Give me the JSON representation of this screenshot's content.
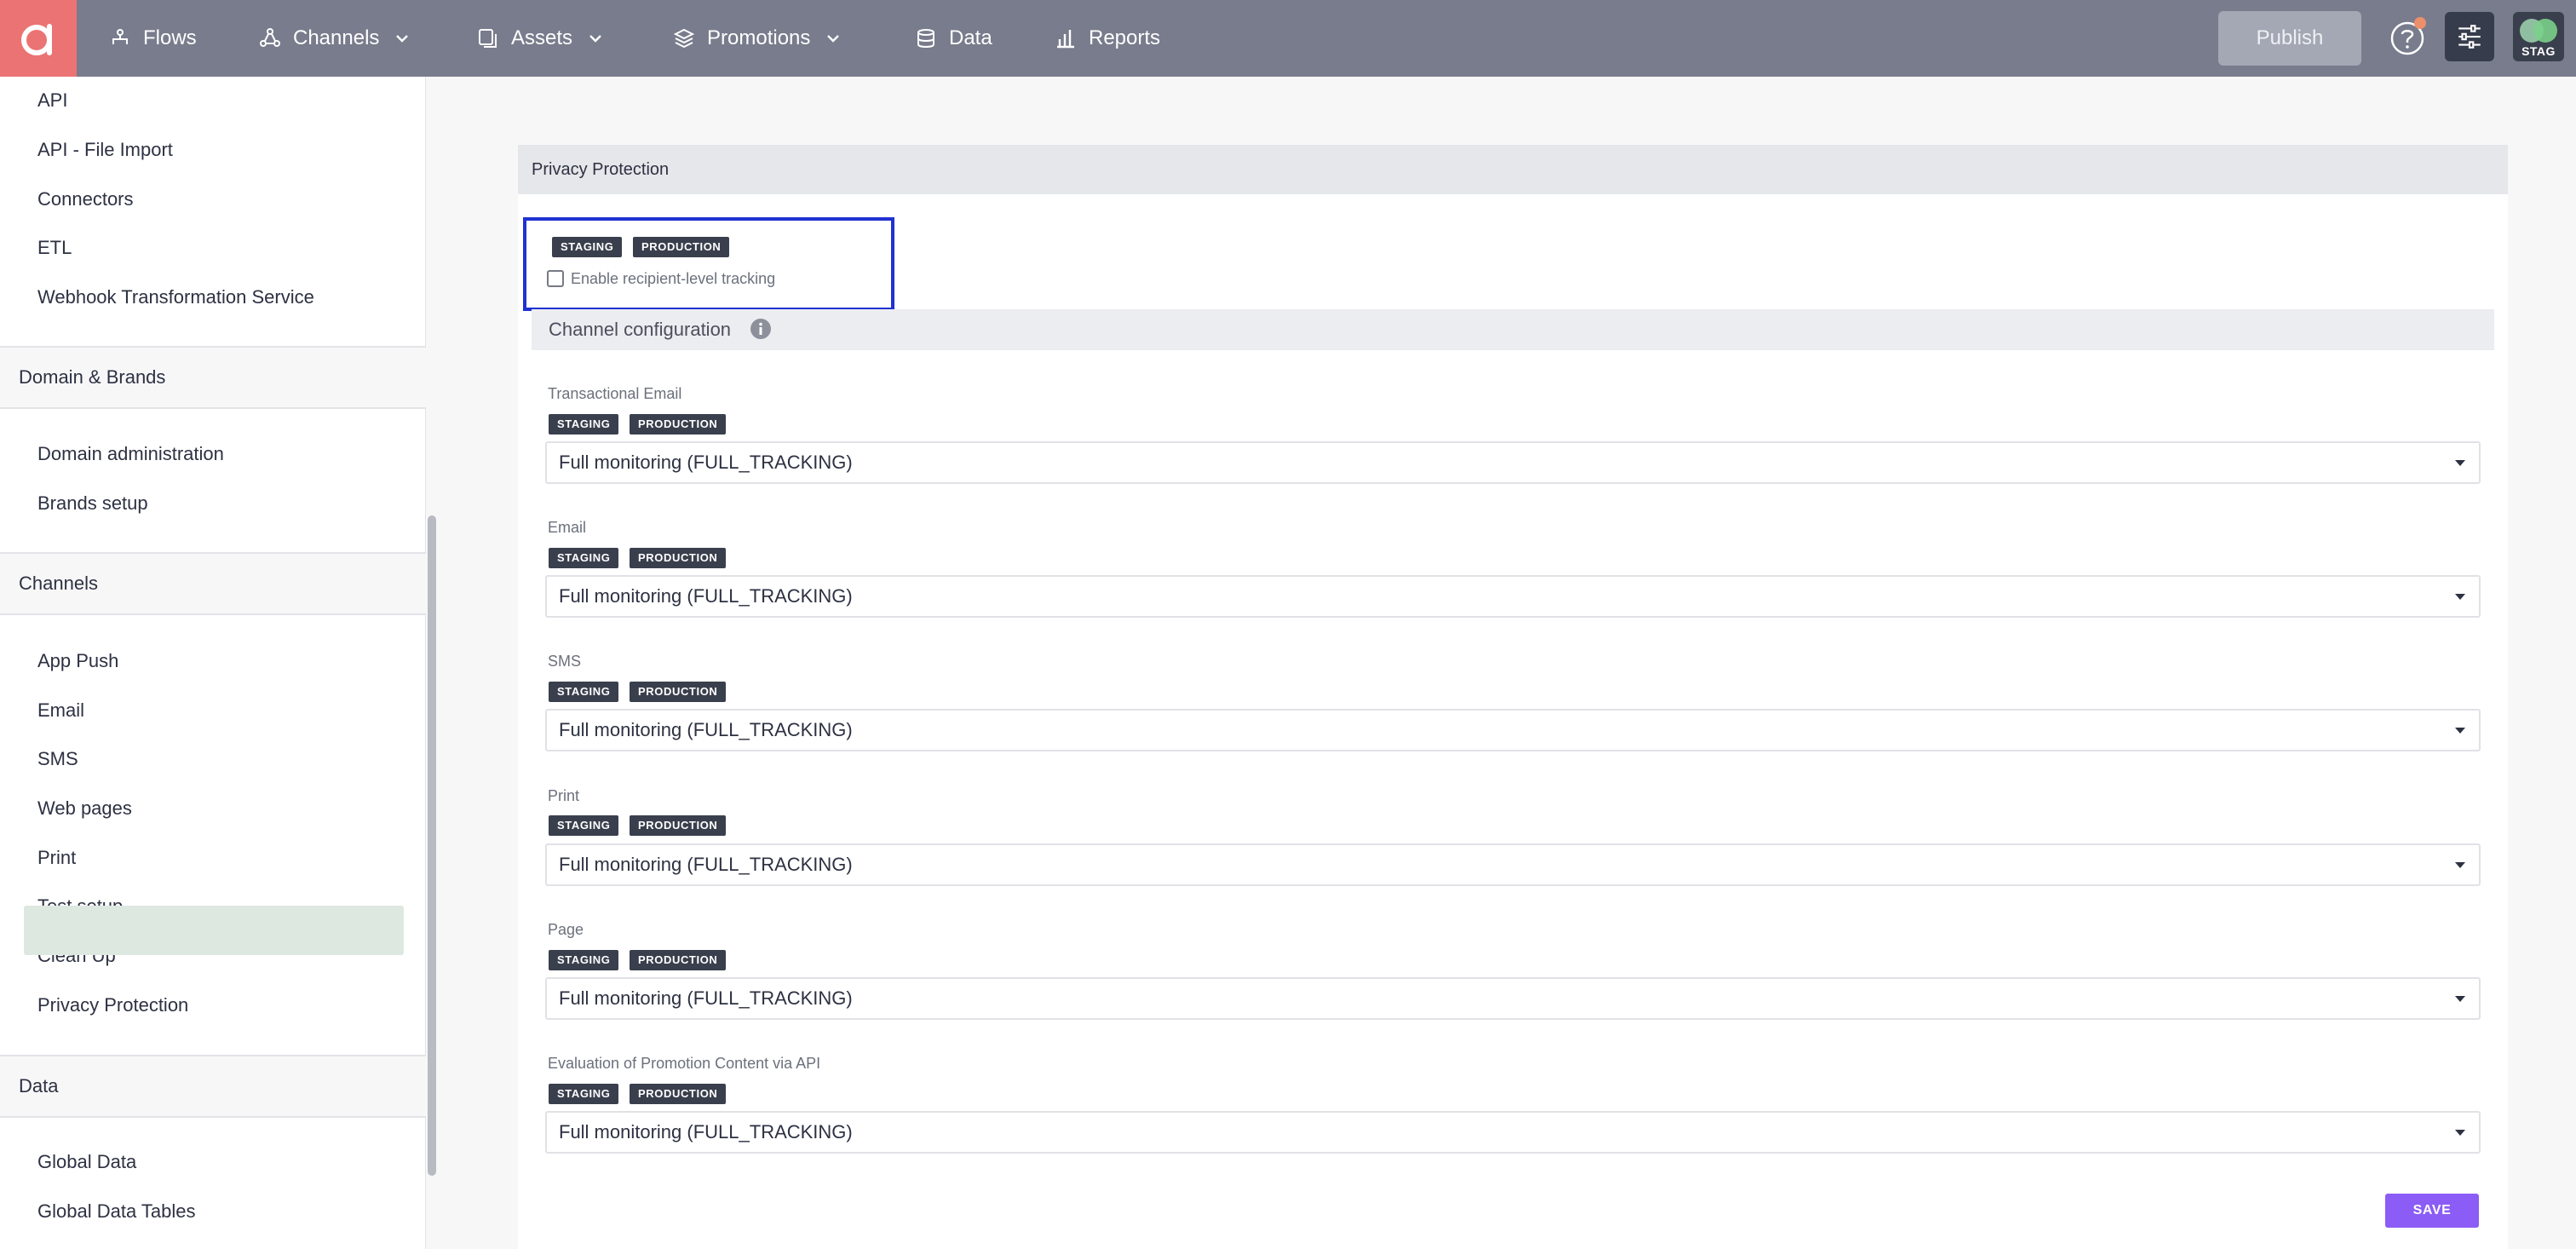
{
  "topbar": {
    "nav": [
      {
        "label": "Flows",
        "icon": "flows-icon",
        "has_dropdown": false
      },
      {
        "label": "Channels",
        "icon": "channels-icon",
        "has_dropdown": true
      },
      {
        "label": "Assets",
        "icon": "assets-icon",
        "has_dropdown": true
      },
      {
        "label": "Promotions",
        "icon": "promotions-icon",
        "has_dropdown": true
      },
      {
        "label": "Data",
        "icon": "database-icon",
        "has_dropdown": false
      },
      {
        "label": "Reports",
        "icon": "bar-chart-icon",
        "has_dropdown": false
      }
    ],
    "publish_label": "Publish",
    "env_label": "STAG",
    "colors": {
      "bar": "#787c8c",
      "logo": "#ec7373",
      "notification_dot": "#ec8f6b"
    }
  },
  "sidebar": {
    "group1": [
      "API",
      "API - File Import",
      "Connectors",
      "ETL",
      "Webhook Transformation Service"
    ],
    "section_domain": "Domain & Brands",
    "group2": [
      "Domain administration",
      "Brands setup"
    ],
    "section_channels": "Channels",
    "group3": [
      "App Push",
      "Email",
      "SMS",
      "Web pages",
      "Print",
      "Test setup",
      "Clean Up",
      "Privacy Protection"
    ],
    "active_item": "Privacy Protection",
    "section_data": "Data",
    "group4": [
      "Global Data",
      "Global Data Tables"
    ]
  },
  "main": {
    "panel_title": "Privacy Protection",
    "tags": {
      "staging": "STAGING",
      "production": "PRODUCTION"
    },
    "tracking_checkbox_label": "Enable recipient-level tracking",
    "tracking_checked": false,
    "config_title": "Channel configuration",
    "channels": [
      {
        "label": "Transactional Email",
        "value": "Full monitoring (FULL_TRACKING)"
      },
      {
        "label": "Email",
        "value": "Full monitoring (FULL_TRACKING)"
      },
      {
        "label": "SMS",
        "value": "Full monitoring (FULL_TRACKING)"
      },
      {
        "label": "Print",
        "value": "Full monitoring (FULL_TRACKING)"
      },
      {
        "label": "Page",
        "value": "Full monitoring (FULL_TRACKING)"
      },
      {
        "label": "Evaluation of Promotion Content via API",
        "value": "Full monitoring (FULL_TRACKING)"
      }
    ],
    "save_label": "SAVE",
    "colors": {
      "highlight": "#1f32d1",
      "save": "#8b5cf6",
      "tag": "#3a3f4d"
    }
  }
}
